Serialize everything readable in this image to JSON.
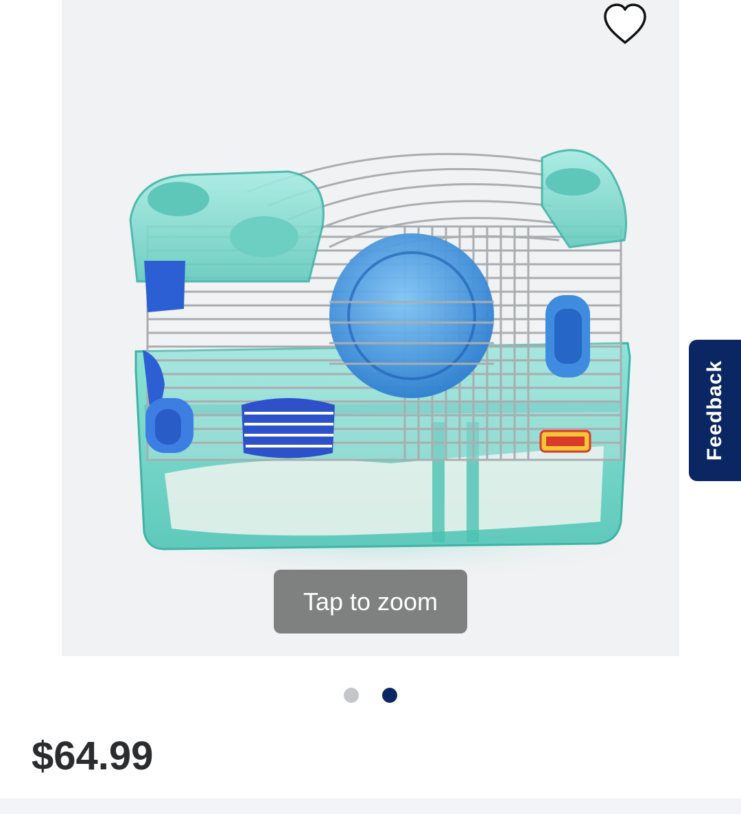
{
  "product": {
    "image_alt": "Hamster cage with blue accessories",
    "zoom_hint": "Tap to zoom",
    "price": "$64.99"
  },
  "favorite": {
    "icon": "heart-outline-icon"
  },
  "feedback": {
    "label": "Feedback",
    "color": "#0b2763"
  },
  "carousel": {
    "total": 2,
    "active_index": 1,
    "inactive_color": "#c4c6c8",
    "active_color": "#0b2763"
  }
}
